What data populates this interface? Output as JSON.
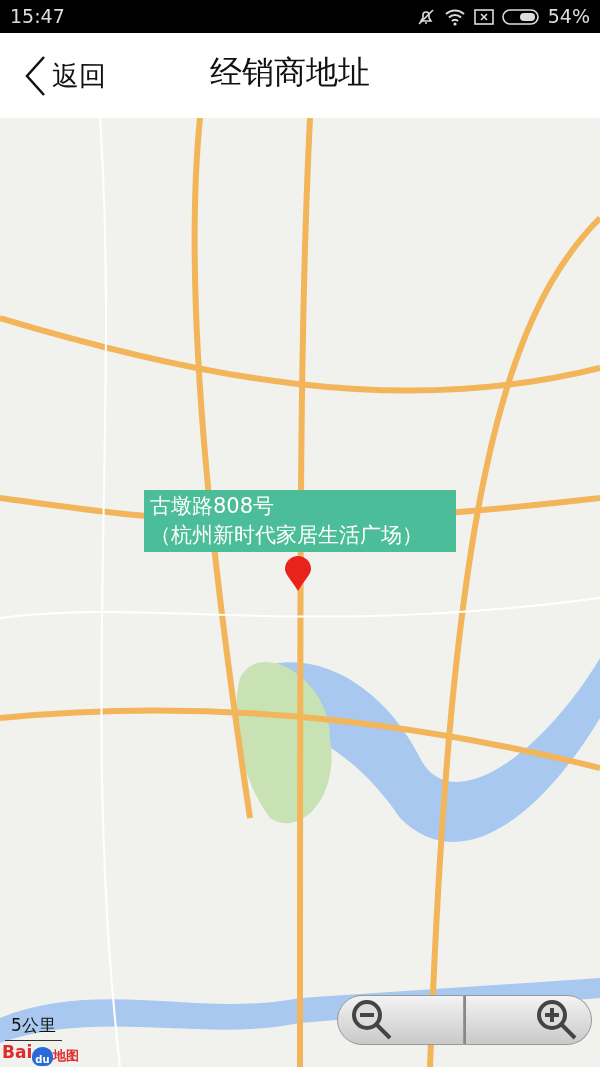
{
  "status_bar": {
    "time": "15:47",
    "battery": "54%"
  },
  "header": {
    "back_label": "返回",
    "title": "经销商地址"
  },
  "map": {
    "info_window": {
      "lines": [
        "古墩路808号",
        "（杭州新时代家居生活广场）"
      ]
    },
    "scale": "5公里",
    "logo": [
      "Bai",
      "du",
      "地图"
    ]
  }
}
